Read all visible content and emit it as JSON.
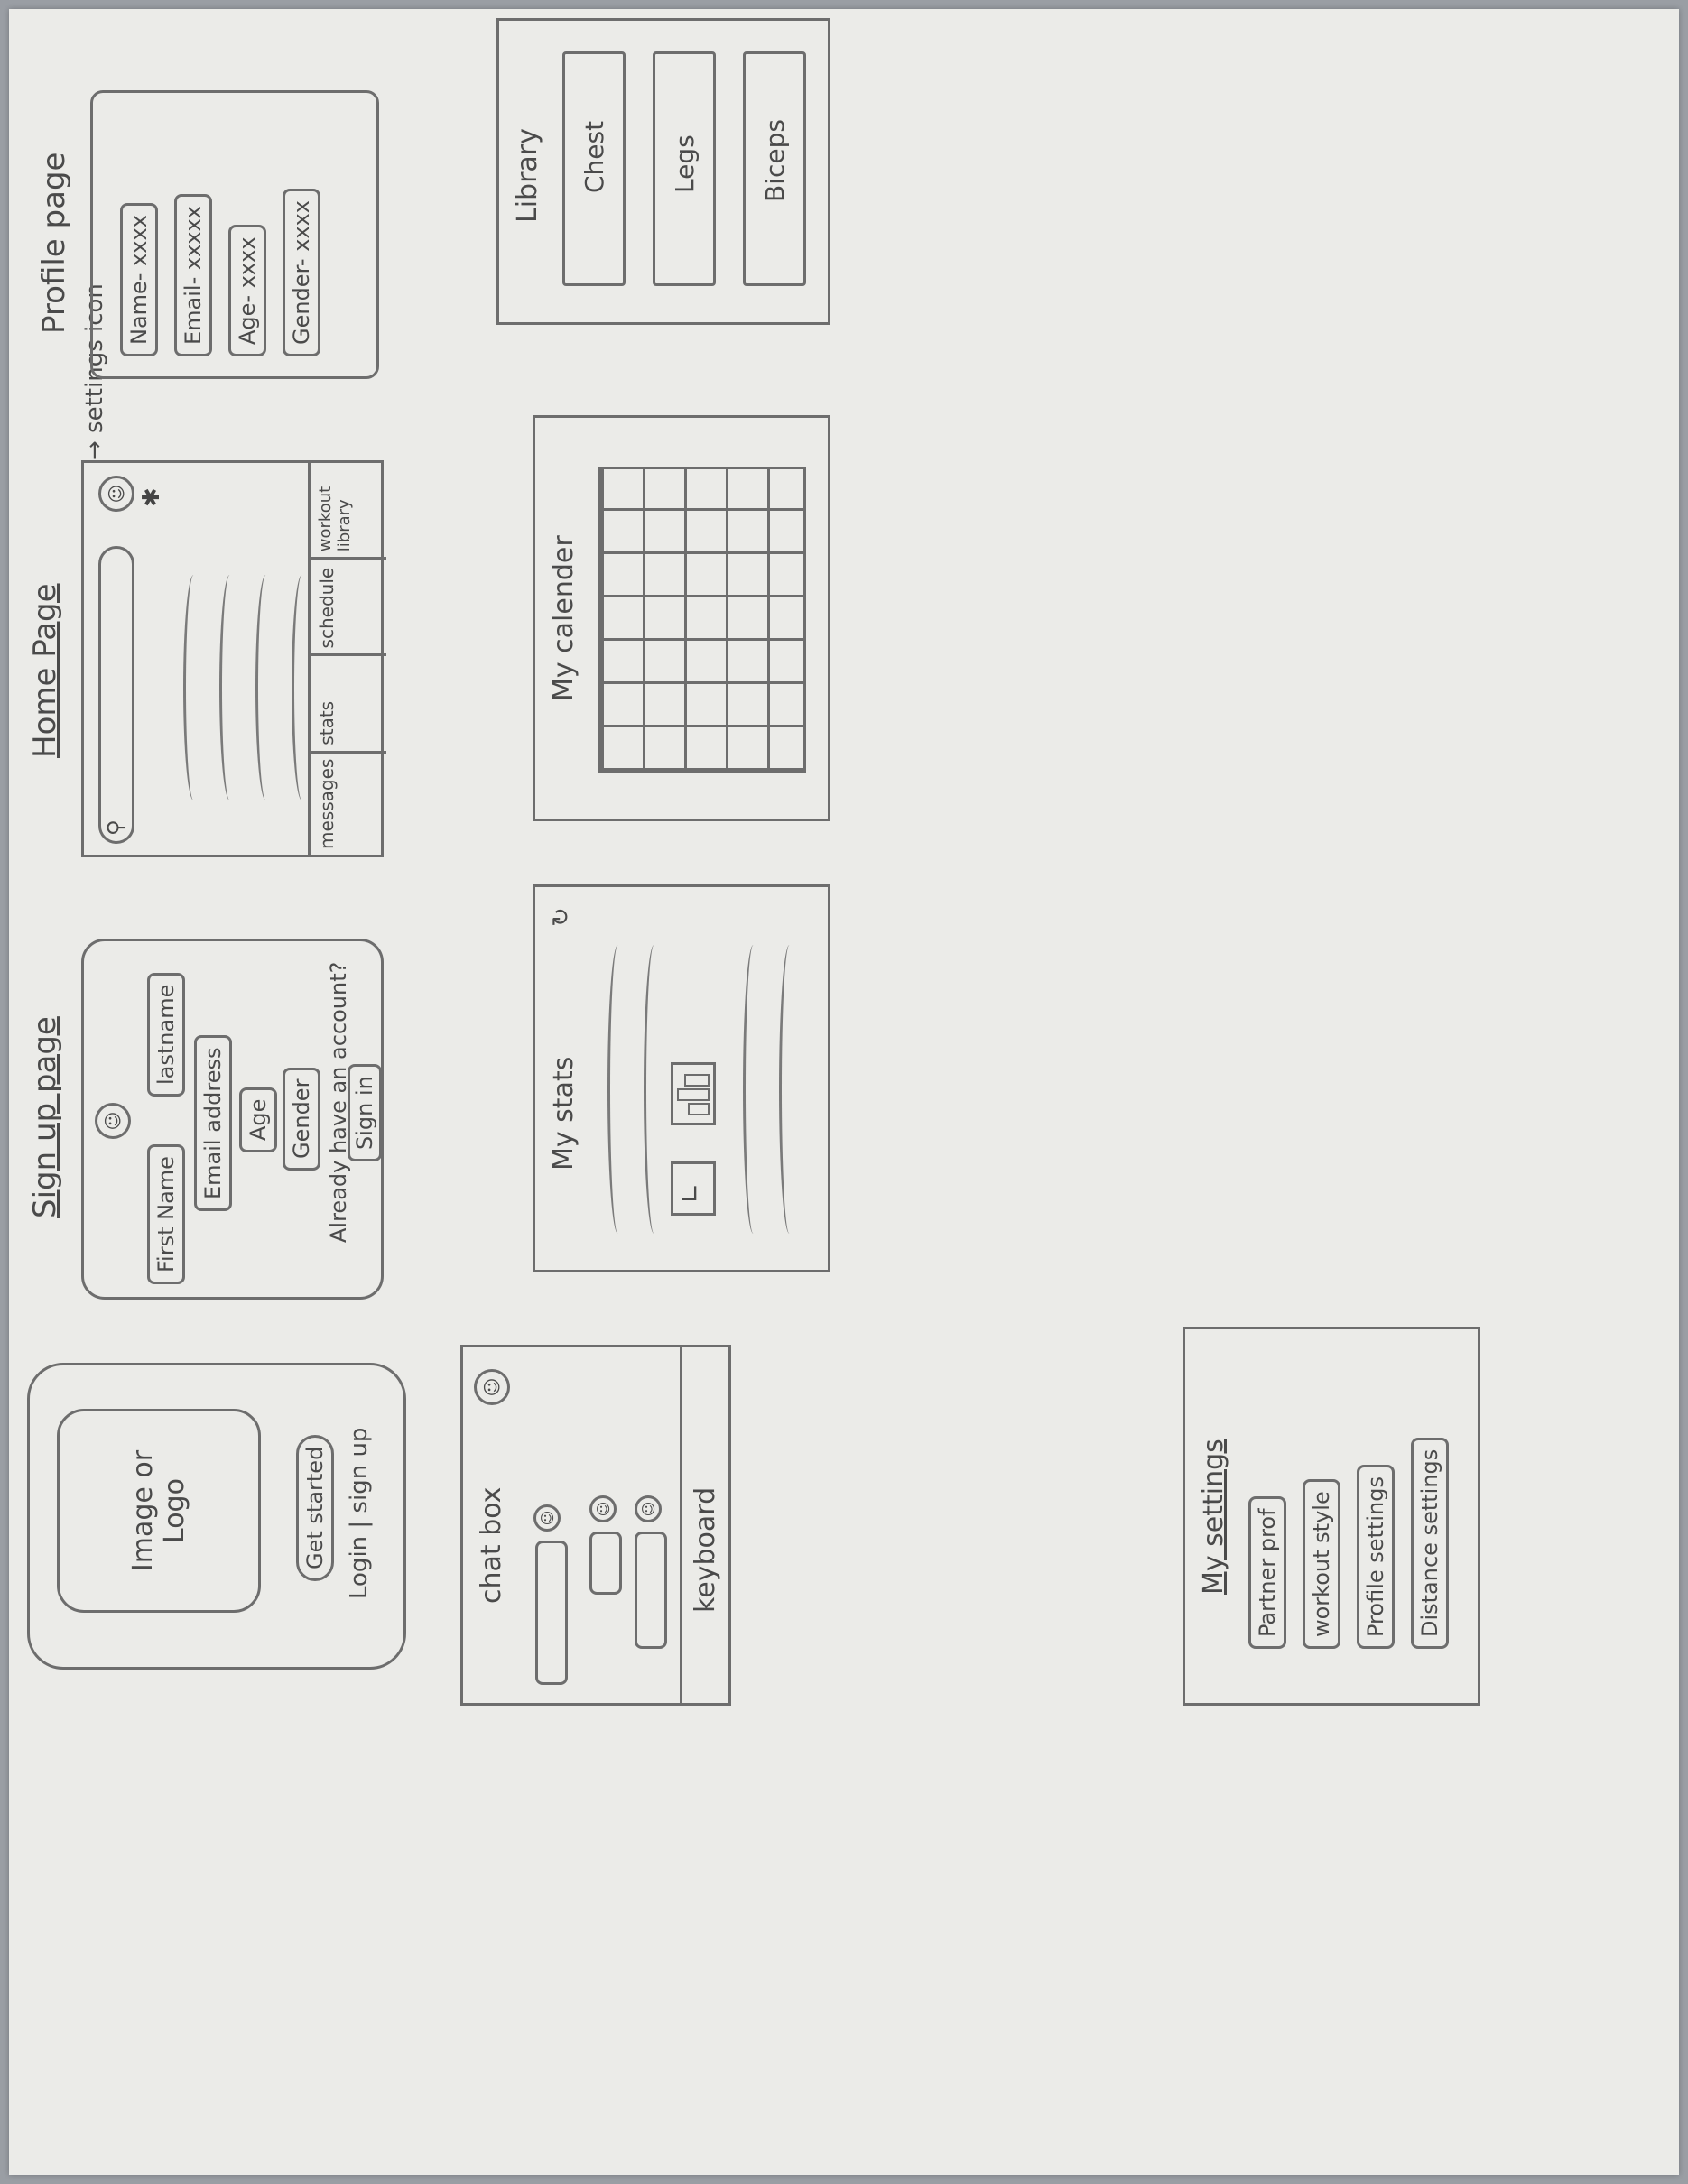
{
  "pages": {
    "signup": {
      "title": "Sign up page",
      "first_name": "First Name",
      "last_name": "lastname",
      "email": "Email address",
      "age": "Age",
      "gender": "Gender",
      "already": "Already have an account?",
      "sign_in": "Sign in"
    },
    "home": {
      "title": "Home Page",
      "settings_note": "settings icon",
      "tabs": [
        "messages",
        "stats",
        "schedule",
        "workout library"
      ]
    },
    "profile": {
      "title": "Profile page",
      "fields": [
        "Name- xxxx",
        "Email- xxxxx",
        "Age- xxxx",
        "Gender- xxxx"
      ]
    },
    "splash": {
      "image_label": "Image or Logo",
      "get_started": "Get started",
      "login_signup": "Login | sign up"
    },
    "stats": {
      "title": "My stats"
    },
    "calendar": {
      "title": "My calender"
    },
    "library": {
      "title": "Library",
      "items": [
        "Chest",
        "Legs",
        "Biceps"
      ]
    },
    "chat": {
      "title": "chat box",
      "keyboard": "keyboard"
    },
    "settings": {
      "title": "My settings",
      "items": [
        "Partner prof",
        "workout style",
        "Profile settings",
        "Distance settings"
      ]
    }
  }
}
